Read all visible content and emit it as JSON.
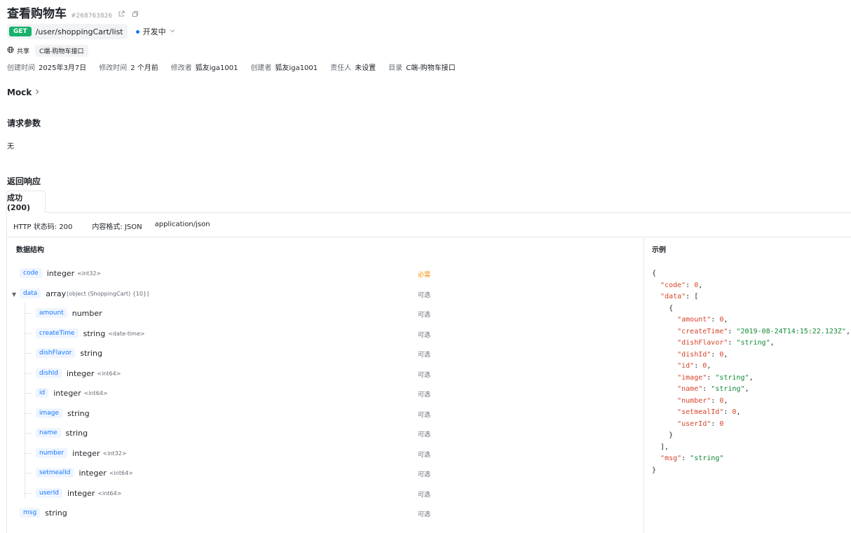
{
  "header": {
    "title": "查看购物车",
    "api_id": "#268763826"
  },
  "request": {
    "method": "GET",
    "path": "/user/shoppingCart/list",
    "status": "开发中"
  },
  "share": {
    "label": "共享",
    "tag": "C端-购物车接口"
  },
  "meta": [
    {
      "key": "创建时间",
      "value": "2025年3月7日"
    },
    {
      "key": "修改时间",
      "value": "2 个月前"
    },
    {
      "key": "修改者",
      "value": "狐友iga1001"
    },
    {
      "key": "创建者",
      "value": "狐友iga1001"
    },
    {
      "key": "责任人",
      "value": "未设置"
    },
    {
      "key": "目录",
      "value": "C端-购物车接口"
    }
  ],
  "mock_label": "Mock",
  "request_params": {
    "title": "请求参数",
    "value": "无"
  },
  "response": {
    "title": "返回响应",
    "tab": "成功(200)",
    "http_status": "HTTP 状态码: 200",
    "content_format": "内容格式: JSON",
    "content_type": "application/json",
    "col_struct": "数据结构",
    "col_example": "示例",
    "fields": [
      {
        "name": "code",
        "type": "integer",
        "sub": "<int32>",
        "req": "必需",
        "required": true
      },
      {
        "name": "data",
        "type": "array",
        "sub": "[object (ShoppingCart) {10}]",
        "req": "可选",
        "required": false
      },
      {
        "name": "amount",
        "type": "number",
        "sub": "",
        "req": "可选",
        "required": false
      },
      {
        "name": "createTime",
        "type": "string",
        "sub": "<date-time>",
        "req": "可选",
        "required": false
      },
      {
        "name": "dishFlavor",
        "type": "string",
        "sub": "",
        "req": "可选",
        "required": false
      },
      {
        "name": "dishId",
        "type": "integer",
        "sub": "<int64>",
        "req": "可选",
        "required": false
      },
      {
        "name": "id",
        "type": "integer",
        "sub": "<int64>",
        "req": "可选",
        "required": false
      },
      {
        "name": "image",
        "type": "string",
        "sub": "",
        "req": "可选",
        "required": false
      },
      {
        "name": "name",
        "type": "string",
        "sub": "",
        "req": "可选",
        "required": false
      },
      {
        "name": "number",
        "type": "integer",
        "sub": "<int32>",
        "req": "可选",
        "required": false
      },
      {
        "name": "setmealId",
        "type": "integer",
        "sub": "<int64>",
        "req": "可选",
        "required": false
      },
      {
        "name": "userId",
        "type": "integer",
        "sub": "<int64>",
        "req": "可选",
        "required": false
      },
      {
        "name": "msg",
        "type": "string",
        "sub": "",
        "req": "可选",
        "required": false
      }
    ],
    "example": {
      "code": "0",
      "amount": "0",
      "createTime": "\"2019-08-24T14:15:22.123Z\"",
      "dishFlavor": "\"string\"",
      "dishId": "0",
      "id": "0",
      "image": "\"string\"",
      "name": "\"string\"",
      "number": "0",
      "setmealId": "0",
      "userId": "0",
      "msg": "\"string\""
    }
  }
}
